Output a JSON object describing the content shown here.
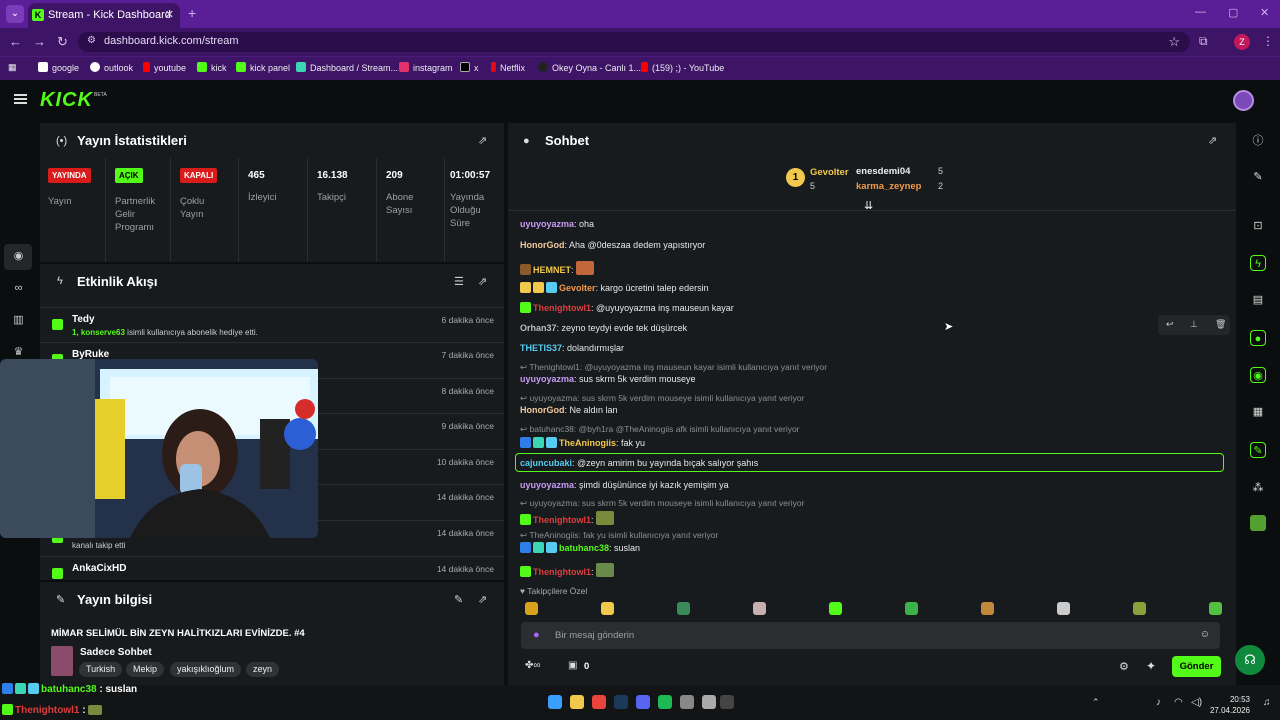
{
  "browser": {
    "tab_title": "Stream - Kick Dashboard",
    "url": "dashboard.kick.com/stream",
    "profile_initial": "Z",
    "bookmarks": [
      "google",
      "outlook",
      "youtube",
      "kick",
      "kick panel",
      "Dashboard / Stream...",
      "instagram",
      "x",
      "Netflix",
      "Okey Oyna - Canlı 1...",
      "(159) ;) - YouTube"
    ]
  },
  "stats_panel": {
    "title": "Yayın İstatistikleri",
    "items": [
      {
        "badge": "YAYINDA",
        "label": "Yayın"
      },
      {
        "badge": "AÇIK",
        "label": "Partnerlik Gelir Programı"
      },
      {
        "badge": "KAPALI",
        "label": "Çoklu Yayın"
      },
      {
        "value": "465",
        "label": "İzleyici"
      },
      {
        "value": "16.138",
        "label": "Takipçi"
      },
      {
        "value": "209",
        "label": "Abone Sayısı"
      },
      {
        "value": "01:00:57",
        "label": "Yayında Olduğu Süre"
      }
    ]
  },
  "activity": {
    "title": "Etkinlik Akışı",
    "items": [
      {
        "name": "Tedy",
        "desc_user": "1, konserve63",
        "desc": " isimli kullanıcıya abonelik hediye etti.",
        "time": "6 dakika önce"
      },
      {
        "name": "ByRuke",
        "desc_user": "",
        "desc": "",
        "time": "7 dakika önce"
      },
      {
        "name": "",
        "desc_user": "",
        "desc": "",
        "time": "8 dakika önce"
      },
      {
        "name": "",
        "desc_user": "",
        "desc": "",
        "time": "9 dakika önce"
      },
      {
        "name": "",
        "desc_user": "",
        "desc": "onelik hediye etti.",
        "time": "10 dakika önce"
      },
      {
        "name": "",
        "desc_user": "",
        "desc": "",
        "time": "14 dakika önce"
      },
      {
        "name": "",
        "desc_user": "",
        "desc": "kanalı takip etti",
        "time": "14 dakika önce"
      },
      {
        "name": "AnkaCixHD",
        "desc_user": "",
        "desc": "",
        "time": "14 dakika önce"
      }
    ]
  },
  "stream_info": {
    "title": "Yayın bilgisi",
    "stream_title": "MİMAR SELİMÜL BİN ZEYN HALİTKIZLARI EVİNİZDE. #4",
    "category": "Sadece Sohbet",
    "tags": [
      "Turkish",
      "Mekip",
      "yakışıklıoğlum",
      "zeyn"
    ]
  },
  "chat": {
    "title": "Sohbet",
    "leaders": {
      "first": "Gevolter",
      "first_count": "5",
      "rank_badge": "1",
      "second": "enesdemi04",
      "second_count": "5",
      "third": "karma_zeynep",
      "third_count": "2"
    },
    "messages": [
      {
        "user": "uyuyoyazma",
        "text": ": oha",
        "color": "#c89bf5"
      },
      {
        "user": "HonorGod",
        "text": ": Aha @0deszaa dedem yapıstıryor",
        "color": "#f0c89b"
      },
      {
        "user": "HEMNET",
        "text": ":",
        "color": "#f2c94c"
      },
      {
        "user": "Gevolter",
        "text": ": kargo ücretini talep edersin",
        "color": "#f2994a"
      },
      {
        "user": "Thenightowl1",
        "text": ": @uyuyoyazma inş mauseun kayar",
        "color": "#e03c3c"
      },
      {
        "user": "Orhan37",
        "text": ": zeyno teydyi evde tek düşürcek",
        "color": "#bdbdbd"
      },
      {
        "user": "THETIS37",
        "text": ": dolandırmışlar",
        "color": "#56ccf2"
      },
      {
        "reply": "Thenightowl1: @uyuyoyazma inş mauseun kayar isimli kullanıcıya yanıt veriyor"
      },
      {
        "user": "uyuyoyazma",
        "text": ": sus skrm 5k verdim mouseye",
        "color": "#c89bf5"
      },
      {
        "reply": "uyuyoyazma: sus skrm 5k verdim mouseye isimli kullanıcıya yanıt veriyor"
      },
      {
        "user": "HonorGod",
        "text": ": Ne aldın lan",
        "color": "#f0c89b"
      },
      {
        "reply": "batuhanc38: @byh1ra @TheAninogiis afk isimli kullanıcıya yanıt veriyor"
      },
      {
        "user": "TheAninogiis",
        "text": ": fak yu",
        "color": "#f2c94c"
      },
      {
        "user": "cajuncubaki",
        "text": ": @zeyn amirim bu yayında bıçak salıyor şahıs",
        "color": "#56ccf2"
      },
      {
        "user": "uyuyoyazma",
        "text": ": şimdi düşününce iyi kazık yemişim ya",
        "color": "#c89bf5"
      },
      {
        "reply": "uyuyoyazma: sus skrm 5k verdim mouseye isimli kullanıcıya yanıt veriyor"
      },
      {
        "user": "Thenightowl1",
        "text": ":",
        "color": "#e03c3c"
      },
      {
        "reply": "TheAninogiis: fak yu isimli kullanıcıya yanıt veriyor"
      },
      {
        "user": "batuhanc38",
        "text": ": suslan",
        "color": "#53fc18"
      },
      {
        "user": "Thenightowl1",
        "text": ":",
        "color": "#e03c3c"
      }
    ],
    "emote_section": "Takipçilere Özel",
    "placeholder": "Bir mesaj gönderin",
    "points": "0",
    "send_label": "Gönder"
  },
  "overlay": {
    "line1_user": "batuhanc38",
    "line1_text": " : suslan",
    "line2_user": "Thenightowl1",
    "line2_text": " :"
  },
  "taskbar": {
    "time": "20:53",
    "date": "27.04.2026"
  }
}
